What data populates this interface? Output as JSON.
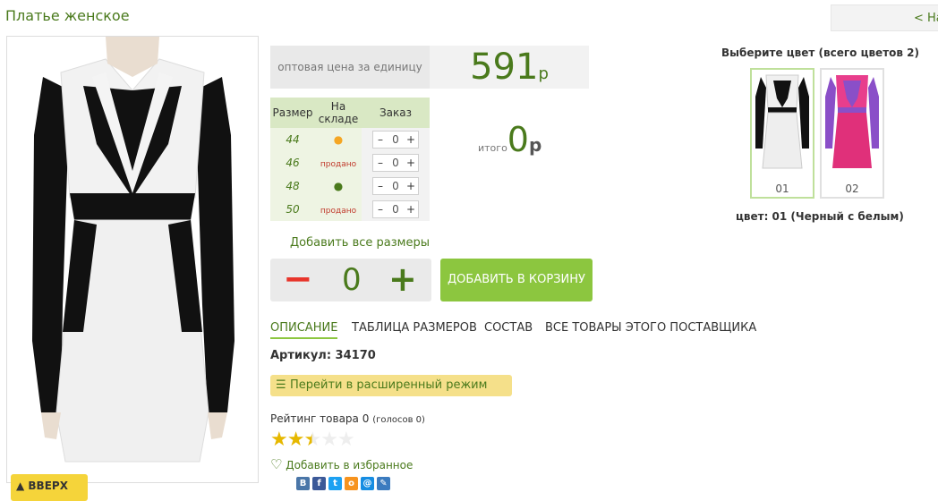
{
  "header": {
    "title": "Платье женское",
    "back_label": "< На"
  },
  "top_button": {
    "label": "ВВЕРХ"
  },
  "price": {
    "label": "оптовая цена за единицу",
    "value": "591",
    "currency": "р"
  },
  "sizes_table": {
    "headers": [
      "Размер",
      "На складе",
      "Заказ"
    ],
    "rows": [
      {
        "size": "44",
        "stock": "●",
        "stock_kind": "orange",
        "qty": "0"
      },
      {
        "size": "46",
        "stock": "продано",
        "stock_kind": "sold",
        "qty": "0"
      },
      {
        "size": "48",
        "stock": "●",
        "stock_kind": "green",
        "qty": "0"
      },
      {
        "size": "50",
        "stock": "продано",
        "stock_kind": "sold",
        "qty": "0"
      }
    ],
    "minus": "–",
    "plus": "+"
  },
  "total": {
    "label": "итого",
    "value": "0",
    "currency": "р"
  },
  "add_all_sizes": "Добавить все размеры",
  "quantity": {
    "minus": "−",
    "value": "0",
    "plus": "+"
  },
  "cart_button": "ДОБАВИТЬ В КОРЗИНУ",
  "tabs": [
    {
      "label": "ОПИСАНИЕ",
      "active": true
    },
    {
      "label": "ТАБЛИЦА РАЗМЕРОВ",
      "active": false
    },
    {
      "label": "СОСТАВ",
      "active": false
    },
    {
      "label": "ВСЕ ТОВАРЫ ЭТОГО ПОСТАВЩИКА",
      "active": false
    }
  ],
  "article": "Артикул: 34170",
  "extended_mode": "Перейти в расширенный режим",
  "rating": {
    "text": "Рейтинг товара 0",
    "votes": "(голосов 0)",
    "stars": 2.5,
    "max": 5
  },
  "favorite": "Добавить в избранное",
  "colors": {
    "title": "Выберите цвет (всего цветов 2)",
    "items": [
      {
        "num": "01",
        "selected": true
      },
      {
        "num": "02",
        "selected": false
      }
    ],
    "selected_label": "цвет: 01 (Черный с белым)"
  },
  "social": [
    "В",
    "f",
    "t",
    "о",
    "@",
    "✎"
  ],
  "accent": "#4a7a1c",
  "button_green": "#8cc63f"
}
